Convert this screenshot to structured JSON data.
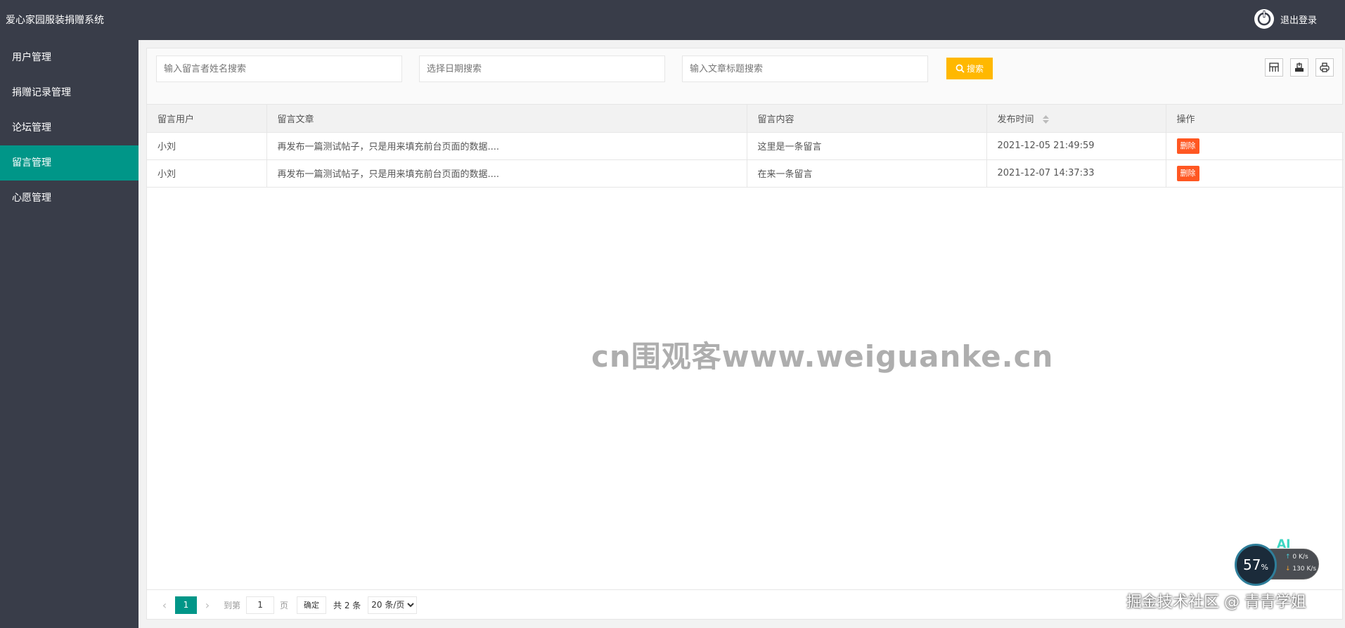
{
  "header": {
    "app_title": "爱心家园服装捐赠系统",
    "logout_label": "退出登录",
    "logout_icon": "power-icon"
  },
  "sidebar": {
    "items": [
      {
        "label": "用户管理",
        "active": false
      },
      {
        "label": "捐赠记录管理",
        "active": false
      },
      {
        "label": "论坛管理",
        "active": false
      },
      {
        "label": "留言管理",
        "active": true
      },
      {
        "label": "心愿管理",
        "active": false
      }
    ]
  },
  "search": {
    "name_placeholder": "输入留言者姓名搜索",
    "date_placeholder": "选择日期搜索",
    "title_placeholder": "输入文章标题搜索",
    "button_label": "搜索"
  },
  "toolbar_icons": [
    "columns-icon",
    "export-icon",
    "print-icon"
  ],
  "table": {
    "columns": [
      "留言用户",
      "留言文章",
      "留言内容",
      "发布时间",
      "操作"
    ],
    "rows": [
      {
        "user": "小刘",
        "article": "再发布一篇测试帖子，只是用来填充前台页面的数据....",
        "content": "这里是一条留言",
        "time": "2021-12-05 21:49:59",
        "action": "删除"
      },
      {
        "user": "小刘",
        "article": "再发布一篇测试帖子，只是用来填充前台页面的数据....",
        "content": "在来一条留言",
        "time": "2021-12-07 14:37:33",
        "action": "删除"
      }
    ]
  },
  "watermark": "cn围观客www.weiguanke.cn",
  "pagination": {
    "current_page": "1",
    "goto_label": "到第",
    "goto_value": "1",
    "page_label": "页",
    "confirm_label": "确定",
    "total_label": "共 2 条",
    "page_size": "20 条/页"
  },
  "netmon": {
    "ai_label": "AI",
    "percent": "57",
    "percent_sign": "%",
    "up_rate": "0 K/s",
    "down_rate": "130 K/s"
  },
  "attribution": "掘金技术社区 @ 青青学姐",
  "colors": {
    "header_bg": "#393d49",
    "active_nav": "#009688",
    "search_btn": "#ffb800",
    "delete_btn": "#ff5722"
  }
}
